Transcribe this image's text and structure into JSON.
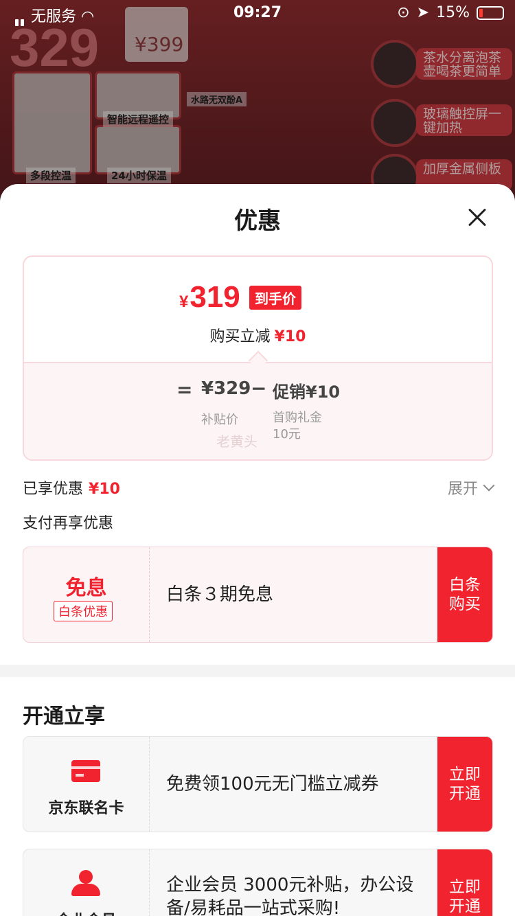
{
  "status_bar": {
    "carrier": "无服务",
    "time": "09:27",
    "battery": "15%"
  },
  "background": {
    "price": "329",
    "old_price": "¥399",
    "labels": [
      "多段控温",
      "24小时保温",
      "智能远程遥控",
      "水路无双酚A"
    ],
    "right_tags": [
      "茶水分离泡茶壶喝茶更简单",
      "玻璃触控屏一键加热",
      "加厚金属侧板"
    ]
  },
  "sheet": {
    "title": "优惠"
  },
  "price_card": {
    "currency": "¥",
    "final_price": "319",
    "hand_price_tag": "到手价",
    "reduce_label": "购买立减",
    "reduce_amount": "¥10",
    "equals": "=",
    "subsidy_price": "¥329",
    "minus": "−",
    "promo_text": "促销¥10",
    "subsidy_label": "补贴价",
    "promo_label_1": "首购礼金",
    "promo_label_2": "10元",
    "watermark": "老黄头"
  },
  "enjoyed": {
    "label": "已享优惠",
    "amount": "¥10",
    "expand": "展开"
  },
  "pay": {
    "title": "支付再享优惠",
    "baitiao": {
      "headline": "免息",
      "tag": "白条优惠",
      "desc": "白条３期免息",
      "cta": "白条购买"
    }
  },
  "open": {
    "title": "开通立享",
    "items": [
      {
        "label": "京东联名卡",
        "desc": "免费领100元无门槛立减券",
        "cta": "立即开通"
      },
      {
        "label": "企业会员",
        "desc": "企业会员 3000元补贴，办公设备/易耗品一站式采购!",
        "cta": "立即开通"
      }
    ]
  },
  "colors": {
    "accent": "#f0232f"
  }
}
